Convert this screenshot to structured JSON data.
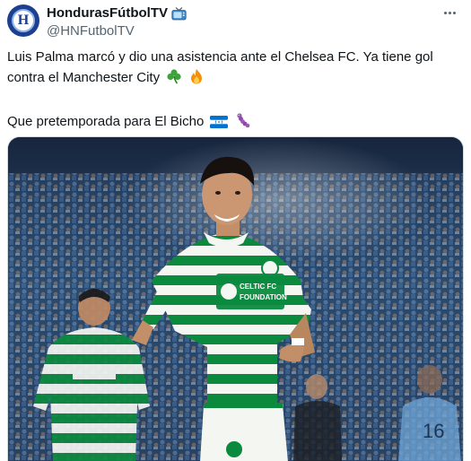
{
  "account": {
    "display_name": "HondurasFútbolTV",
    "handle": "@HNFutbolTV",
    "avatar_letter": "H",
    "verified_icon": "tv-icon"
  },
  "menu": {
    "icon": "more-icon"
  },
  "tweet": {
    "line1": "Luis Palma marcó y dio una asistencia ante el Chelsea FC. Ya tiene gol",
    "line2": "contra el Manchester City",
    "line3": "Que pretemporada para El Bicho",
    "emojis_line2": [
      "shamrock-icon",
      "fire-icon"
    ],
    "emojis_line3": [
      "honduras-flag-icon",
      "caterpillar-icon"
    ]
  },
  "media": {
    "jersey_sponsor": "CELTIC FC FOUNDATION"
  },
  "colors": {
    "brand_blue": "#1c3f8f",
    "celtic_green": "#0b8a3e",
    "text_primary": "#0f1419",
    "text_secondary": "#536471"
  }
}
